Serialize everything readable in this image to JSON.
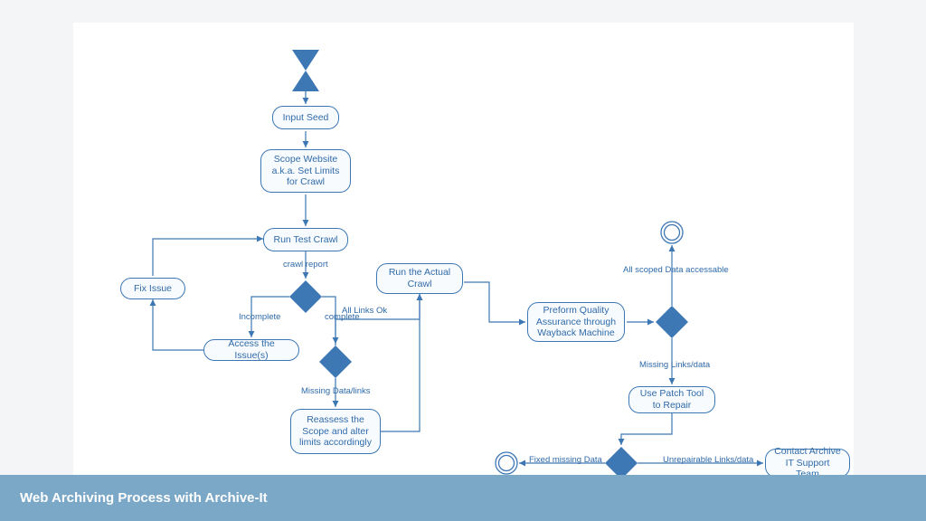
{
  "footer": {
    "title": "Web Archiving Process with Archive-It"
  },
  "diagram": {
    "nodes": {
      "input_seed": "Input Seed",
      "scope_website": "Scope Website a.k.a. Set Limits for Crawl",
      "run_test_crawl": "Run Test Crawl",
      "fix_issue": "Fix Issue",
      "access_issues": "Access the Issue(s)",
      "reassess_scope": "Reassess the Scope and alter limits accordingly",
      "run_actual_crawl": "Run the Actual Crawl",
      "quality_assurance": "Preform Quality Assurance through Wayback Machine",
      "use_patch_tool": "Use Patch Tool to Repair",
      "contact_support": "Contact Archive IT Support Team"
    },
    "labels": {
      "crawl_report": "crawl report",
      "incomplete": "Incomplete",
      "complete": "complete",
      "all_links_ok": "All Links Ok",
      "missing_data_links": "Missing Data/links",
      "all_scoped_accessible": "All scoped Data accessable",
      "missing_links_data": "Missing Links/data",
      "fixed_missing_data": "Fixed missing Data",
      "unrepairable": "Unrepairable Links/data"
    },
    "colors": {
      "accent": "#3d78b5",
      "fill": "#f8fbfe",
      "diamond": "#3d78b5"
    }
  }
}
